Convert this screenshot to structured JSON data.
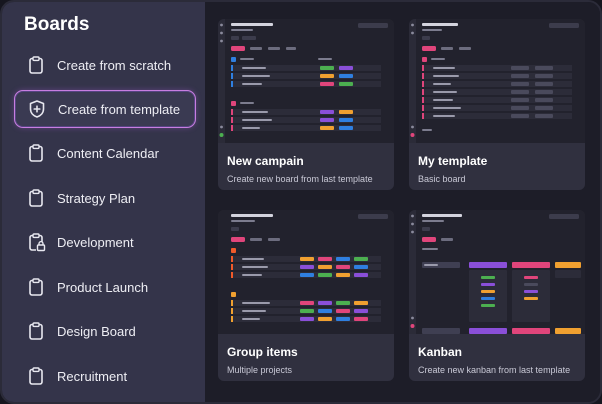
{
  "sidebar": {
    "title": "Boards",
    "items": [
      {
        "label": "Create from scratch",
        "icon": "clipboard-icon"
      },
      {
        "label": "Create from template",
        "icon": "shield-plus-icon",
        "active": true
      },
      {
        "label": "Content Calendar",
        "icon": "clipboard-icon"
      },
      {
        "label": "Strategy Plan",
        "icon": "clipboard-icon"
      },
      {
        "label": "Development",
        "icon": "clipboard-lock-icon"
      },
      {
        "label": "Product Launch",
        "icon": "clipboard-icon"
      },
      {
        "label": "Design Board",
        "icon": "clipboard-icon"
      },
      {
        "label": "Recruitment",
        "icon": "clipboard-icon"
      }
    ]
  },
  "templates": [
    {
      "title": "New campain",
      "subtitle": "Create new board from last template"
    },
    {
      "title": "My template",
      "subtitle": "Basic board"
    },
    {
      "title": "Group items",
      "subtitle": "Multiple projects"
    },
    {
      "title": "Kanban",
      "subtitle": "Create new kanban from last template"
    }
  ],
  "colors": {
    "sidebar_bg": "#34344a",
    "main_bg": "#1d1d28",
    "card_bg": "#30303f",
    "active_border": "#c87ee0",
    "accent_pink": "#e0457b",
    "accent_blue": "#2f7fe0",
    "accent_green": "#4caf50",
    "accent_purple": "#8a4fd8",
    "accent_orange": "#f0a030"
  }
}
